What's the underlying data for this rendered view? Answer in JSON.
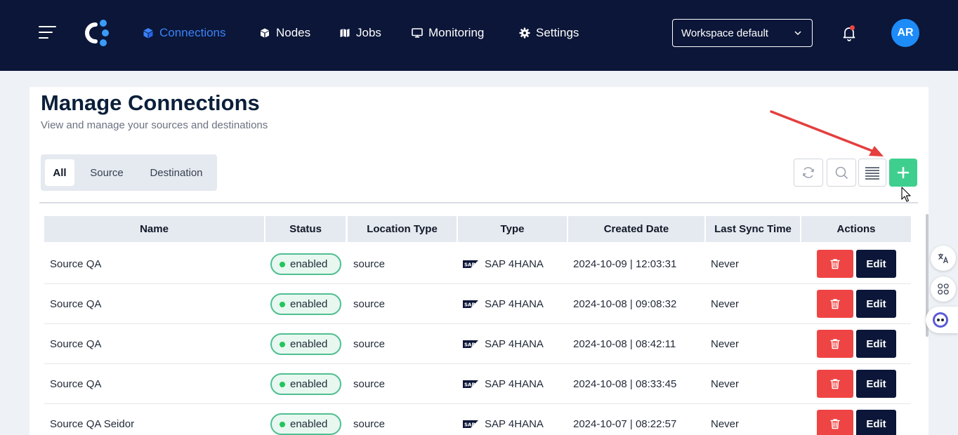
{
  "nav": {
    "items": [
      {
        "label": "Connections",
        "icon": "cube-icon",
        "active": true
      },
      {
        "label": "Nodes",
        "icon": "box-icon"
      },
      {
        "label": "Jobs",
        "icon": "map-icon"
      },
      {
        "label": "Monitoring",
        "icon": "monitor-icon"
      },
      {
        "label": "Settings",
        "icon": "gear-icon"
      }
    ],
    "workspace": "Workspace default",
    "avatar_initials": "AR"
  },
  "page": {
    "title": "Manage Connections",
    "subtitle": "View and manage your sources and destinations"
  },
  "filters": {
    "tabs": [
      "All",
      "Source",
      "Destination"
    ],
    "active": "All"
  },
  "toolbar": {
    "icons": [
      "refresh-icon",
      "search-icon",
      "list-icon",
      "plus-icon"
    ]
  },
  "table": {
    "columns": [
      "Name",
      "Status",
      "Location Type",
      "Type",
      "Created Date",
      "Last Sync Time",
      "Actions"
    ],
    "rows": [
      {
        "name": "Source QA",
        "status": "enabled",
        "location_type": "source",
        "type": "SAP 4HANA",
        "created": "2024-10-09 | 12:03:31",
        "last_sync": "Never"
      },
      {
        "name": "Source QA",
        "status": "enabled",
        "location_type": "source",
        "type": "SAP 4HANA",
        "created": "2024-10-08 | 09:08:32",
        "last_sync": "Never"
      },
      {
        "name": "Source QA",
        "status": "enabled",
        "location_type": "source",
        "type": "SAP 4HANA",
        "created": "2024-10-08 | 08:42:11",
        "last_sync": "Never"
      },
      {
        "name": "Source QA",
        "status": "enabled",
        "location_type": "source",
        "type": "SAP 4HANA",
        "created": "2024-10-08 | 08:33:45",
        "last_sync": "Never"
      },
      {
        "name": "Source QA Seidor",
        "status": "enabled",
        "location_type": "source",
        "type": "SAP 4HANA",
        "created": "2024-10-07 | 08:22:57",
        "last_sync": "Never"
      }
    ],
    "edit_label": "Edit"
  },
  "colors": {
    "nav_bg": "#0b1638",
    "accent": "#3b82f6",
    "add_button": "#3ecf8e",
    "delete_button": "#ef4444",
    "status_green": "#22c55e"
  }
}
